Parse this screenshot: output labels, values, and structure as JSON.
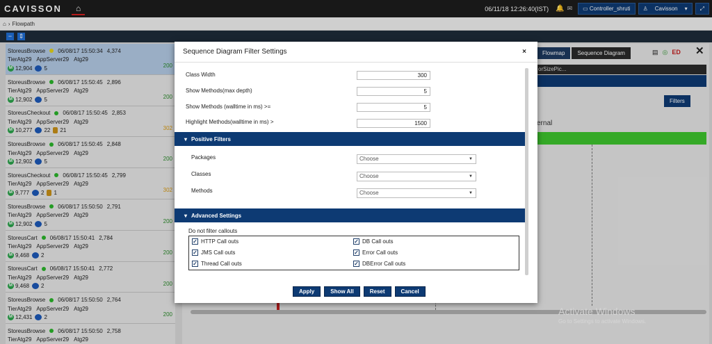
{
  "app": {
    "logo": "CAVISSON",
    "datetime": "06/11/18 12:26:40(IST)",
    "controller_label": "Controller_shruti",
    "user_label": "Cavisson"
  },
  "breadcrumb": {
    "current": "Flowpath"
  },
  "flowpaths": [
    {
      "name": "StoreusBrowse",
      "status": "yellow",
      "time": "06/08/17 15:50:34",
      "count": "4,374",
      "tier": "TierAtg29",
      "server": "AppServer29",
      "app": "Atg29",
      "methods": "12,904",
      "calls": "5",
      "db": "",
      "resp": "200",
      "resp_color": "green"
    },
    {
      "name": "StoreusBrowse",
      "status": "green",
      "time": "06/08/17 15:50:45",
      "count": "2,896",
      "tier": "TierAtg29",
      "server": "AppServer29",
      "app": "Atg29",
      "methods": "12,902",
      "calls": "5",
      "db": "",
      "resp": "200",
      "resp_color": "green"
    },
    {
      "name": "StoreusCheckout",
      "status": "green",
      "time": "06/08/17 15:50:45",
      "count": "2,853",
      "tier": "TierAtg29",
      "server": "AppServer29",
      "app": "Atg29",
      "methods": "10,277",
      "calls": "22",
      "db": "21",
      "resp": "302",
      "resp_color": "orange"
    },
    {
      "name": "StoreusBrowse",
      "status": "green",
      "time": "06/08/17 15:50:45",
      "count": "2,848",
      "tier": "TierAtg29",
      "server": "AppServer29",
      "app": "Atg29",
      "methods": "12,902",
      "calls": "5",
      "db": "",
      "resp": "200",
      "resp_color": "green"
    },
    {
      "name": "StoreusCheckout",
      "status": "green",
      "time": "06/08/17 15:50:45",
      "count": "2,799",
      "tier": "TierAtg29",
      "server": "AppServer29",
      "app": "Atg29",
      "methods": "9,777",
      "calls": "2",
      "db": "1",
      "resp": "302",
      "resp_color": "orange"
    },
    {
      "name": "StoreusBrowse",
      "status": "green",
      "time": "06/08/17 15:50:50",
      "count": "2,791",
      "tier": "TierAtg29",
      "server": "AppServer29",
      "app": "Atg29",
      "methods": "12,902",
      "calls": "5",
      "db": "",
      "resp": "200",
      "resp_color": "green"
    },
    {
      "name": "StoreusCart",
      "status": "green",
      "time": "06/08/17 15:50:41",
      "count": "2,784",
      "tier": "TierAtg29",
      "server": "AppServer29",
      "app": "Atg29",
      "methods": "9,468",
      "calls": "2",
      "db": "",
      "resp": "200",
      "resp_color": "green"
    },
    {
      "name": "StoreusCart",
      "status": "green",
      "time": "06/08/17 15:50:41",
      "count": "2,772",
      "tier": "TierAtg29",
      "server": "AppServer29",
      "app": "Atg29",
      "methods": "9,468",
      "calls": "2",
      "db": "",
      "resp": "200",
      "resp_color": "green"
    },
    {
      "name": "StoreusBrowse",
      "status": "green",
      "time": "06/08/17 15:50:50",
      "count": "2,764",
      "tier": "TierAtg29",
      "server": "AppServer29",
      "app": "Atg29",
      "methods": "12,431",
      "calls": "2",
      "db": "",
      "resp": "200",
      "resp_color": "green"
    },
    {
      "name": "StoreusBrowse",
      "status": "green",
      "time": "06/08/17 15:50:50",
      "count": "2,758",
      "tier": "TierAtg29",
      "server": "AppServer29",
      "app": "Atg29",
      "methods": "",
      "calls": "",
      "db": "",
      "resp": "",
      "resp_color": "green"
    }
  ],
  "right": {
    "tab_flowmap": "Flowmap",
    "tab_sequence": "Sequence Diagram",
    "strip_text": "orSizePic...",
    "filters_label": "Filters",
    "col_label": "ernal",
    "watermark": "Activate Windows",
    "watermark_sub": "Go to Settings to activate Windows."
  },
  "modal": {
    "title": "Sequence Diagram Filter Settings",
    "close": "×",
    "fields": {
      "class_width": {
        "label": "Class Width",
        "value": "300"
      },
      "show_methods_depth": {
        "label": "Show Methods(max depth)",
        "value": "5"
      },
      "show_methods_walltime": {
        "label": "Show Methods (walltime in ms) >=",
        "value": "5"
      },
      "highlight_methods": {
        "label": "Highlight Methods(walltime in ms) >",
        "value": "1500"
      }
    },
    "positive_filters": {
      "title": "Positive Filters",
      "packages": {
        "label": "Packages",
        "value": "Choose"
      },
      "classes": {
        "label": "Classes",
        "value": "Choose"
      },
      "methods": {
        "label": "Methods",
        "value": "Choose"
      }
    },
    "advanced": {
      "title": "Advanced Settings",
      "callouts_title": "Do not filter callouts",
      "http": "HTTP Call outs",
      "db": "DB Call outs",
      "jms": "JMS Call outs",
      "error": "Error Call outs",
      "thread": "Thread Call outs",
      "dberror": "DBError Call outs"
    },
    "buttons": {
      "apply": "Apply",
      "show_all": "Show All",
      "reset": "Reset",
      "cancel": "Cancel"
    }
  }
}
